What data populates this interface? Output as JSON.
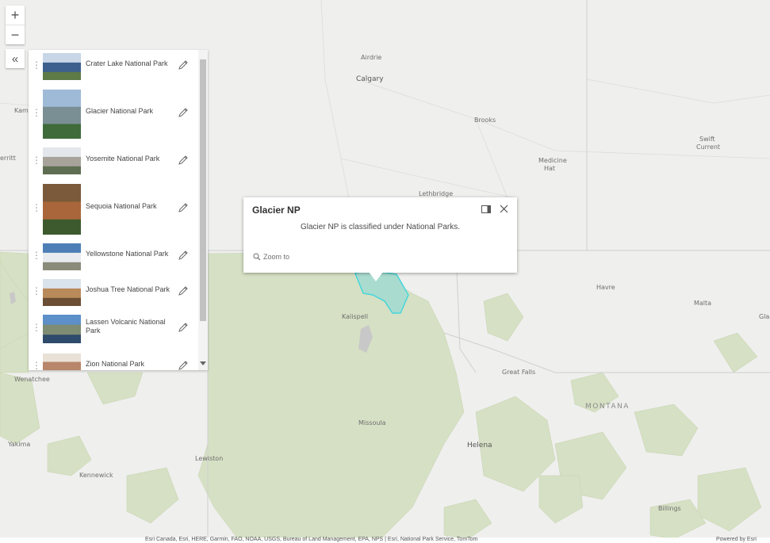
{
  "map": {
    "colors": {
      "land": "#efefee",
      "parks": "#d6e0c4",
      "park_edge": "#c5d3ad",
      "highlight": "#a9dccf",
      "highlight_edge": "#47d6da",
      "border": "#d0d0d0"
    },
    "labels": [
      {
        "text": "Airdrie",
        "cls": "place"
      },
      {
        "text": "Calgary",
        "cls": "place city"
      },
      {
        "text": "Kamlo",
        "cls": "place"
      },
      {
        "text": "erritt",
        "cls": "place"
      },
      {
        "text": "Brooks",
        "cls": "place"
      },
      {
        "text": "Medicine",
        "cls": "place"
      },
      {
        "text": "Hat",
        "cls": "place"
      },
      {
        "text": "Swift",
        "cls": "place"
      },
      {
        "text": "Current",
        "cls": "place"
      },
      {
        "text": "Lethbridge",
        "cls": "place"
      },
      {
        "text": "Havre",
        "cls": "place"
      },
      {
        "text": "Malta",
        "cls": "place"
      },
      {
        "text": "Glas",
        "cls": "place"
      },
      {
        "text": "Kalispell",
        "cls": "place"
      },
      {
        "text": "Great Falls",
        "cls": "place"
      },
      {
        "text": "MONTANA",
        "cls": "place state"
      },
      {
        "text": "Wenatchee",
        "cls": "place"
      },
      {
        "text": "Missoula",
        "cls": "place"
      },
      {
        "text": "Helena",
        "cls": "place city"
      },
      {
        "text": "Yakima",
        "cls": "place"
      },
      {
        "text": "Lewiston",
        "cls": "place"
      },
      {
        "text": "Kennewick",
        "cls": "place"
      },
      {
        "text": "Billings",
        "cls": "place"
      }
    ]
  },
  "controls": {
    "zoom_in": "+",
    "zoom_out": "−",
    "collapse": "«"
  },
  "list": {
    "items": [
      {
        "label": "Crater Lake National Park",
        "thumb": [
          "#c8d6e8",
          "#3d5f8e",
          "#5e7a47"
        ]
      },
      {
        "label": "Glacier National Park",
        "thumb": [
          "#9fbad6",
          "#7a8f94",
          "#3f6b3a"
        ]
      },
      {
        "label": "Yosemite National Park",
        "thumb": [
          "#e3e7ec",
          "#a7a39b",
          "#5f6e52"
        ]
      },
      {
        "label": "Sequoia National Park",
        "thumb": [
          "#7a5a3a",
          "#a8663a",
          "#3d5a2e"
        ]
      },
      {
        "label": "Yellowstone National Park",
        "thumb": [
          "#4d7fb6",
          "#e9ecef",
          "#8b8b7a"
        ]
      },
      {
        "label": "Joshua Tree National Park",
        "thumb": [
          "#d9e3ec",
          "#b98a5a",
          "#6b4e34"
        ]
      },
      {
        "label": "Lassen Volcanic National Park",
        "thumb": [
          "#5d8fc8",
          "#7f8c74",
          "#2e4b6b"
        ]
      },
      {
        "label": "Zion National Park",
        "thumb": [
          "#e9e1d6",
          "#b8866a",
          "#7b5a44"
        ]
      }
    ]
  },
  "popup": {
    "title": "Glacier NP",
    "body": "Glacier NP is classified under National Parks.",
    "zoom_to": "Zoom to"
  },
  "attribution": {
    "left": "Esri Canada, Esri, HERE, Garmin, FAO, NOAA, USGS, Bureau of Land Management, EPA, NPS | Esri, National Park Service, TomTom",
    "right": "Powered by Esri"
  }
}
